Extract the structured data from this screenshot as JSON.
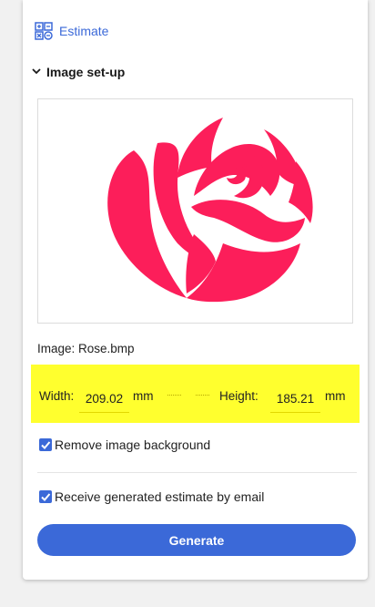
{
  "header": {
    "estimate_label": "Estimate",
    "estimate_icon": "calculator-icon"
  },
  "section": {
    "title": "Image set-up",
    "toggle_icon": "chevron-down-icon"
  },
  "image": {
    "name_text": "Image: Rose.bmp",
    "preview_icon": "rose-image"
  },
  "size": {
    "width_label": "Width:",
    "width_value": "209.02",
    "width_unit": "mm",
    "height_label": "Height:",
    "height_value": "185.21",
    "height_unit": "mm"
  },
  "options": {
    "remove_background_label": "Remove image background",
    "remove_background_checked": true,
    "email_estimate_label": "Receive generated estimate by email",
    "email_estimate_checked": true
  },
  "actions": {
    "generate_label": "Generate"
  },
  "colors": {
    "accent": "#3b69d8",
    "highlight": "#ffff2e",
    "rose": "#fc1e5a"
  }
}
